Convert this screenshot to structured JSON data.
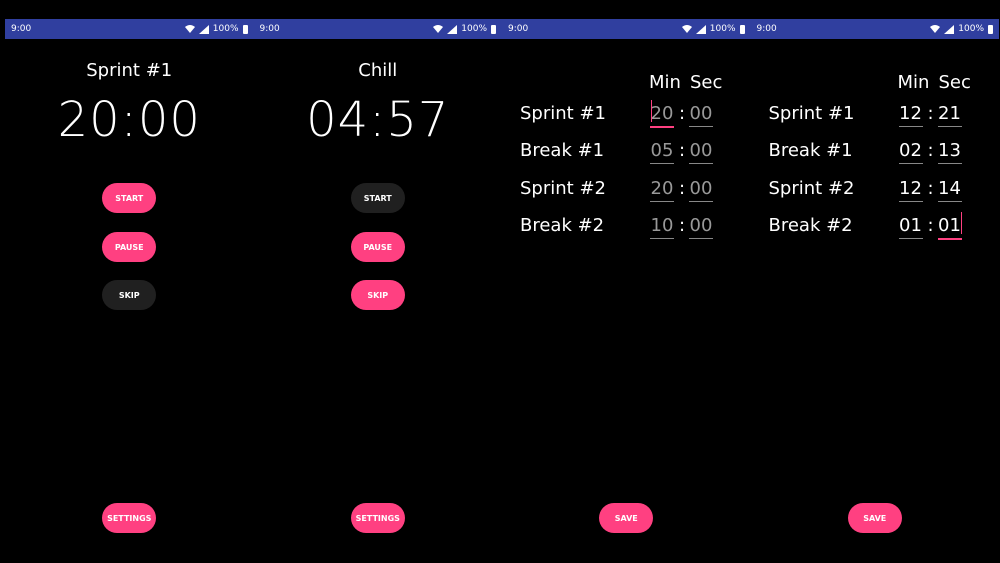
{
  "status": {
    "time": "9:00",
    "battery": "100%"
  },
  "screen1": {
    "title": "Sprint #1",
    "clock": "20:00",
    "start": "START",
    "pause": "PAUSE",
    "skip": "SKIP",
    "settings": "SETTINGS"
  },
  "screen2": {
    "title": "Chill",
    "clock": "04:57",
    "start": "START",
    "pause": "PAUSE",
    "skip": "SKIP",
    "settings": "SETTINGS"
  },
  "settings_common": {
    "min_header": "Min",
    "sec_header": "Sec",
    "colon": ":",
    "save": "SAVE"
  },
  "screen3": {
    "rows": [
      {
        "label": "Sprint #1",
        "min": "20",
        "sec": "00"
      },
      {
        "label": "Break #1",
        "min": "05",
        "sec": "00"
      },
      {
        "label": "Sprint #2",
        "min": "20",
        "sec": "00"
      },
      {
        "label": "Break #2",
        "min": "10",
        "sec": "00"
      }
    ]
  },
  "screen4": {
    "rows": [
      {
        "label": "Sprint #1",
        "min": "12",
        "sec": "21"
      },
      {
        "label": "Break #1",
        "min": "02",
        "sec": "13"
      },
      {
        "label": "Sprint #2",
        "min": "12",
        "sec": "14"
      },
      {
        "label": "Break #2",
        "min": "01",
        "sec": "01"
      }
    ]
  },
  "colors": {
    "accent": "#ff4081",
    "statusbar": "#303f9f",
    "disabled_button": "#202020"
  },
  "icons": {
    "wifi": "wifi-icon",
    "signal": "signal-icon",
    "battery": "battery-icon"
  }
}
